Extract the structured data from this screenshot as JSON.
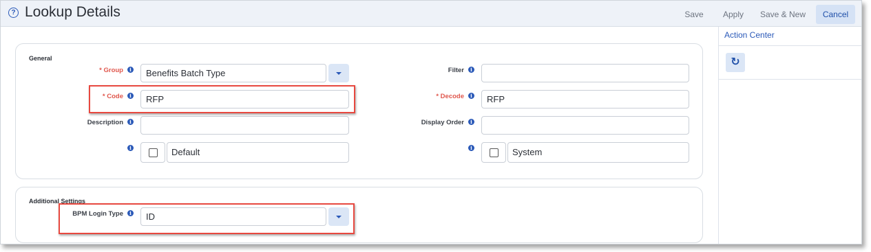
{
  "header": {
    "title": "Lookup Details",
    "help_icon": "?",
    "buttons": {
      "save": "Save",
      "apply": "Apply",
      "save_new": "Save & New",
      "cancel": "Cancel"
    }
  },
  "action_center": {
    "title": "Action Center",
    "refresh_icon": "↻"
  },
  "general": {
    "title": "General",
    "group": {
      "label": "* Group",
      "value": "Benefits Batch Type"
    },
    "code": {
      "label": "* Code",
      "value": "RFP"
    },
    "description": {
      "label": "Description",
      "value": ""
    },
    "default": {
      "label": "Default",
      "checked": false
    },
    "filter": {
      "label": "Filter",
      "value": ""
    },
    "decode": {
      "label": "* Decode",
      "value": "RFP"
    },
    "display_order": {
      "label": "Display Order",
      "value": ""
    },
    "system": {
      "label": "System",
      "checked": false
    }
  },
  "additional": {
    "title": "Additional Settings",
    "bpm_login_type": {
      "label": "BPM Login Type",
      "value": "ID"
    }
  },
  "info_glyph": "i",
  "colors": {
    "accent": "#2a59b8",
    "required": "#e0574d",
    "highlight": "#e8483f",
    "header_bg": "#eef2f8"
  }
}
